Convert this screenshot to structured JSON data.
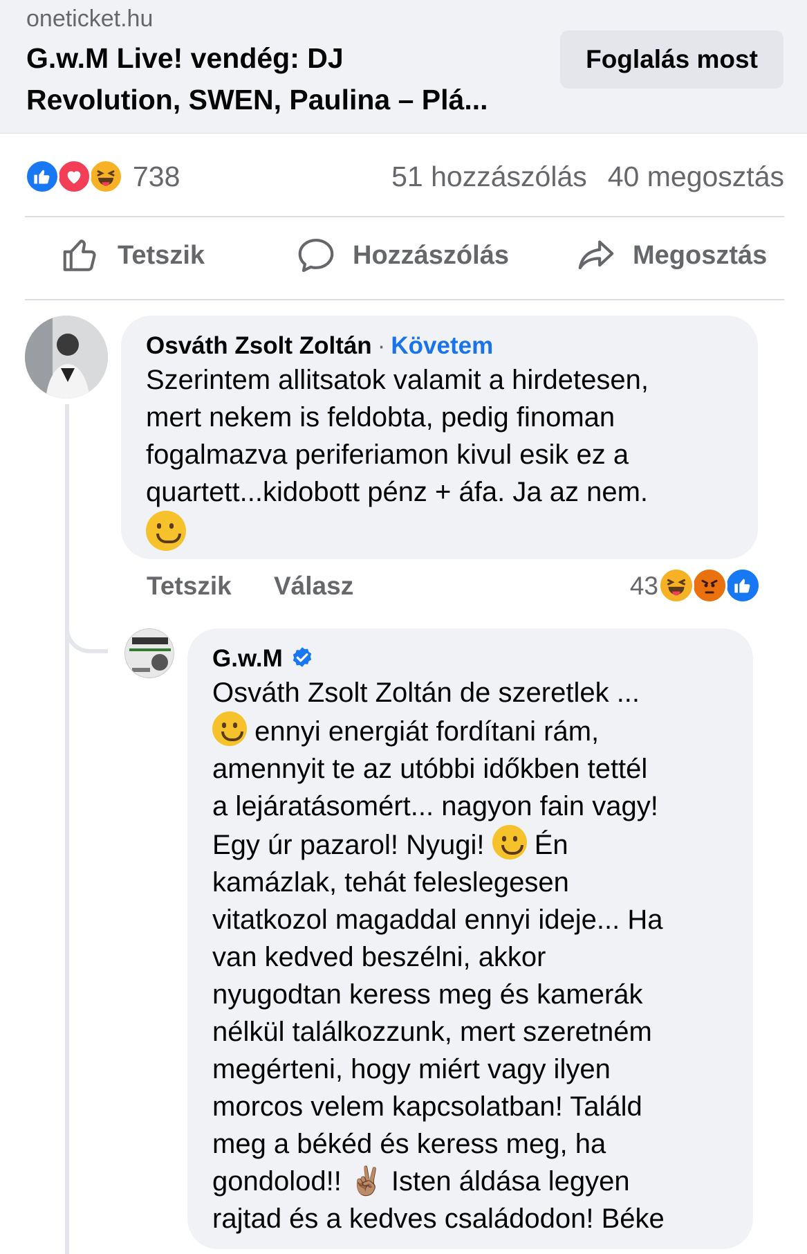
{
  "link_preview": {
    "domain": "oneticket.hu",
    "title_line1": "G.w.M Live! vendég: DJ",
    "title_line2": "Revolution, SWEN, Paulina – Plá...",
    "button_label": "Foglalás most"
  },
  "stats": {
    "reaction_count": "738",
    "comments": "51 hozzászólás",
    "shares": "40 megosztás",
    "reaction_icons": [
      "like-icon",
      "love-icon",
      "haha-icon"
    ]
  },
  "actions": {
    "like": "Tetszik",
    "comment": "Hozzászólás",
    "share": "Megosztás"
  },
  "comment1": {
    "author": "Osváth Zsolt Zoltán",
    "separator": "·",
    "follow": "Követem",
    "lines": [
      "Szerintem allitsatok valamit a hirdetesen,",
      "mert nekem is feldobta, pedig finoman",
      "fogalmazva periferiamon kivul esik ez a",
      "quartett...kidobott pénz + áfa. Ja az nem."
    ],
    "like_label": "Tetszik",
    "reply_label": "Válasz",
    "reaction_count": "43",
    "reaction_icons": [
      "haha-icon",
      "angry-icon",
      "like-icon"
    ]
  },
  "comment2": {
    "author": "G.w.M",
    "verified": true,
    "l1": "Osváth Zsolt Zoltán de szeretlek ...",
    "l2": " ennyi energiát fordítani rám,",
    "l3": "amennyit te az utóbbi időkben tettél",
    "l4": "a lejáratásomért... nagyon fain vagy!",
    "l5a": "Egy úr pazarol! Nyugi! ",
    "l5b": " Én",
    "l6": "kamázlak, tehát feleslegesen",
    "l7": "vitatkozol magaddal ennyi ideje... Ha",
    "l8": "van kedved beszélni, akkor",
    "l9": "nyugodtan keress meg és kamerák",
    "l10": "nélkül találkozzunk, mert szeretném",
    "l11": "megérteni, hogy miért vagy ilyen",
    "l12": "morcos velem kapcsolatban! Találd",
    "l13": "meg a békéd és keress meg, ha",
    "l14a": "gondolod!! ",
    "l14b": "✌🏽",
    "l14c": " Isten áldása legyen",
    "l15": "rajtad és a kedves családodon! Béke"
  },
  "colors": {
    "link_blue": "#1a73e8",
    "like_blue": "#1877f2",
    "love_red": "#f33e58",
    "haha_yellow": "#f7b125",
    "angry_orange": "#e9710f",
    "muted_text": "#65676b",
    "bubble_bg": "#f0f2f5"
  }
}
